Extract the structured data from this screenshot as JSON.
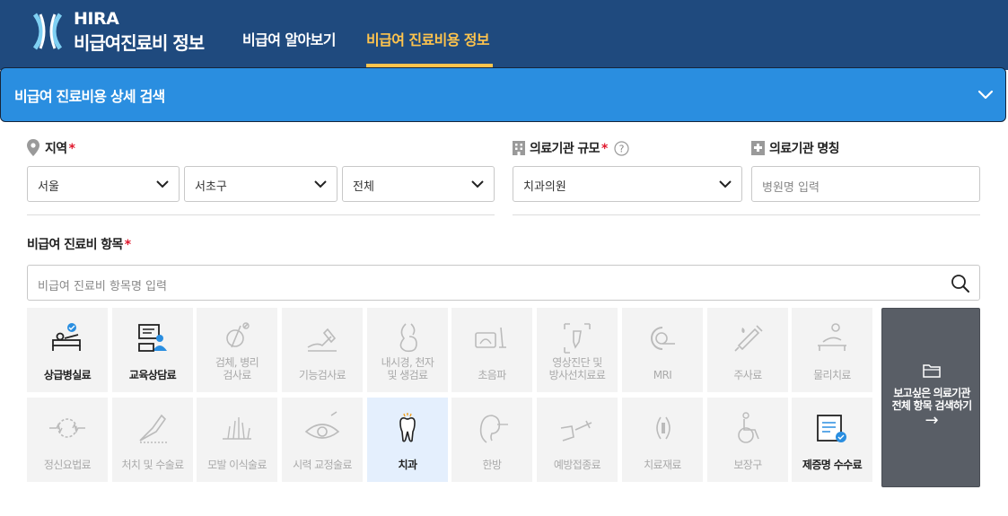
{
  "header": {
    "brand_small": "HIRA",
    "brand_big": "비급여진료비 정보",
    "nav": [
      {
        "label": "비급여 알아보기",
        "active": false
      },
      {
        "label": "비급여 진료비용 정보",
        "active": true
      }
    ]
  },
  "search_panel": {
    "title": "비급여 진료비용 상세 검색",
    "icon": "chevron-down-icon"
  },
  "filters": {
    "region": {
      "label": "지역",
      "required": "*",
      "icon": "location-pin-icon",
      "selects": [
        "서울",
        "서초구",
        "전체"
      ]
    },
    "facility_size": {
      "label": "의료기관 규모",
      "required": "*",
      "help": "?",
      "icon": "building-icon",
      "selected": "치과의원"
    },
    "facility_name": {
      "label": "의료기관 명칭",
      "icon": "hospital-icon",
      "placeholder": "병원명 입력"
    }
  },
  "items": {
    "label": "비급여 진료비 항목",
    "required": "*",
    "search_placeholder": "비급여 진료비 항목명 입력",
    "search_icon": "search-icon",
    "categories_row1": [
      {
        "line1": "상급병실료",
        "line2": "",
        "icon": "hospital-bed-icon",
        "enabled": true
      },
      {
        "line1": "교육상담료",
        "line2": "",
        "icon": "counseling-icon",
        "enabled": true
      },
      {
        "line1": "검체, 병리",
        "line2": "검사료",
        "icon": "microscope-icon",
        "enabled": false
      },
      {
        "line1": "기능검사료",
        "line2": "",
        "icon": "function-test-icon",
        "enabled": false
      },
      {
        "line1": "내시경, 천자",
        "line2": "및 생검료",
        "icon": "endoscope-icon",
        "enabled": false
      },
      {
        "line1": "초음파",
        "line2": "",
        "icon": "ultrasound-icon",
        "enabled": false
      },
      {
        "line1": "영상진단 및",
        "line2": "방사선치료료",
        "icon": "xray-icon",
        "enabled": false
      },
      {
        "line1": "MRI",
        "line2": "",
        "icon": "mri-icon",
        "enabled": false
      },
      {
        "line1": "주사료",
        "line2": "",
        "icon": "syringe-icon",
        "enabled": false
      },
      {
        "line1": "물리치료",
        "line2": "",
        "icon": "physiotherapy-icon",
        "enabled": false
      }
    ],
    "categories_row2": [
      {
        "line1": "정신요법료",
        "line2": "",
        "icon": "brain-icon",
        "enabled": false
      },
      {
        "line1": "처치 및 수술료",
        "line2": "",
        "icon": "surgery-icon",
        "enabled": false
      },
      {
        "line1": "모발 이식술료",
        "line2": "",
        "icon": "hair-icon",
        "enabled": false
      },
      {
        "line1": "시력 교정술료",
        "line2": "",
        "icon": "eye-icon",
        "enabled": false
      },
      {
        "line1": "치과",
        "line2": "",
        "icon": "tooth-icon",
        "enabled": true,
        "selected": true
      },
      {
        "line1": "한방",
        "line2": "",
        "icon": "ear-acupuncture-icon",
        "enabled": false
      },
      {
        "line1": "예방접종료",
        "line2": "",
        "icon": "vaccine-icon",
        "enabled": false
      },
      {
        "line1": "치료재료",
        "line2": "",
        "icon": "medical-material-icon",
        "enabled": false
      },
      {
        "line1": "보장구",
        "line2": "",
        "icon": "wheelchair-icon",
        "enabled": false
      },
      {
        "line1": "제증명 수수료",
        "line2": "",
        "icon": "certificate-icon",
        "enabled": true
      }
    ],
    "side_button": {
      "line1": "보고싶은 의료기관",
      "line2": "전체 항목 검색하기",
      "icon": "folder-icon",
      "arrow": "→"
    }
  },
  "colors": {
    "header_bg": "#1f4a7e",
    "accent_yellow": "#ffc44d",
    "panel_blue": "#2a8ee0",
    "required_red": "#e0182d",
    "selected_tile": "#e4effd"
  }
}
